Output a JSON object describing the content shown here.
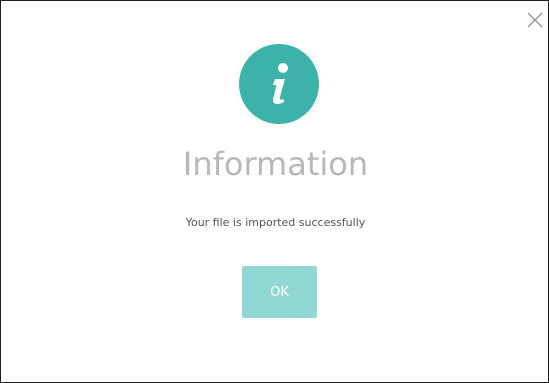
{
  "dialog": {
    "close_icon": "close-icon",
    "badge_icon": "info-icon",
    "title": "Information",
    "message": "Your file is imported successfully",
    "ok_label": "OK"
  },
  "colors": {
    "accent": "#3bb3a8",
    "button": "#91d7d3",
    "title_text": "#b8b8b8",
    "message_text": "#555555"
  }
}
